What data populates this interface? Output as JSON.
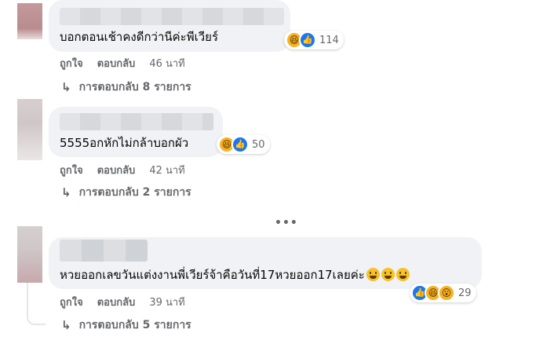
{
  "comments": [
    {
      "text": "บอกตอนเช้าคงดีกว่านีค่ะพีเวียร์",
      "reaction_count": "114",
      "reactions": [
        "haha-icon",
        "like-icon"
      ],
      "like_label": "ถูกใจ",
      "reply_label": "ตอบกลับ",
      "time": "46 นาที",
      "replies_label": "การตอบกลับ 8 รายการ"
    },
    {
      "text": "5555อกหักไม่กล้าบอกผัว",
      "reaction_count": "50",
      "reactions": [
        "haha-icon",
        "like-icon"
      ],
      "like_label": "ถูกใจ",
      "reply_label": "ตอบกลับ",
      "time": "42 นาที",
      "replies_label": "การตอบกลับ 2 รายการ"
    },
    {
      "text": "หวยออกเลขวันแต่งงานพี่เวียร์จ้าคือวันที่17หวยออก17เลยค่ะ",
      "reaction_count": "29",
      "reactions": [
        "like-icon",
        "haha-icon",
        "wow-icon"
      ],
      "like_label": "ถูกใจ",
      "reply_label": "ตอบกลับ",
      "time": "39 นาที",
      "replies_label": "การตอบกลับ 5 รายการ"
    }
  ],
  "more_indicator": "•••",
  "colors": {
    "bubble": "#f0f2f5",
    "meta": "#65676b",
    "like": "#1877f2",
    "haha": "#f7b125"
  }
}
